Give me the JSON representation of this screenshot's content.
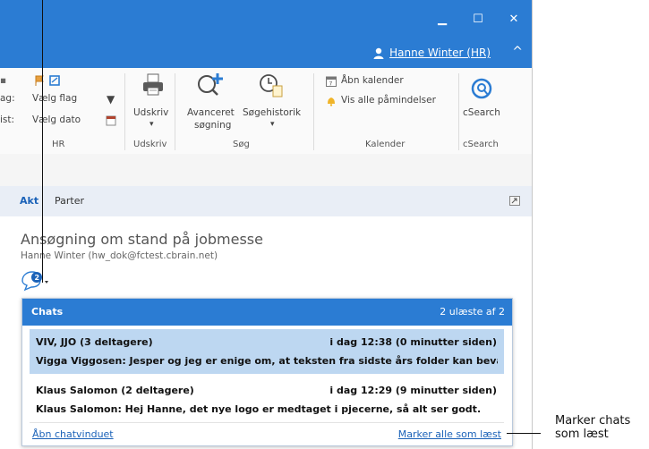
{
  "window": {
    "minimize_glyph": "▁",
    "maximize_glyph": "☐",
    "close_glyph": "✕"
  },
  "user": {
    "name": "Hanne Winter (HR)",
    "collapse_glyph": "^"
  },
  "ribbon": {
    "hr_group": {
      "left_cut_1": "ag:",
      "left_cut_2": "ist:",
      "flag_label": "Vælg flag",
      "date_label": "Vælg dato",
      "group_name": "HR"
    },
    "print_group": {
      "label": "Udskriv",
      "dropdown_glyph": "▾",
      "group_name": "Udskriv"
    },
    "search_group": {
      "advanced_label_1": "Avanceret",
      "advanced_label_2": "søgning",
      "history_label": "Søgehistorik",
      "dropdown_glyph": "▾",
      "group_name": "Søg"
    },
    "calendar_group": {
      "open_label": "Åbn kalender",
      "reminders_label": "Vis alle påmindelser",
      "group_name": "Kalender"
    },
    "csearch_group": {
      "label": "cSearch",
      "group_name": "cSearch"
    }
  },
  "tabs": [
    {
      "label": "Akt"
    },
    {
      "label": "Parter"
    }
  ],
  "document": {
    "subject": "Ansøgning om stand på jobmesse",
    "sender": "Hanne Winter (hw_dok@fctest.cbrain.net)",
    "chat_badge": "2"
  },
  "chats_popup": {
    "title": "Chats",
    "unread_status": "2 ulæste af 2",
    "items": [
      {
        "name": "VIV, JJO (3 deltagere)",
        "time": "i dag 12:38 (0 minutter siden)",
        "message": "Vigga Viggosen: Jesper og jeg er enige om, at teksten fra sidste års folder kan bevar...",
        "selected": true
      },
      {
        "name": "Klaus Salomon (2 deltagere)",
        "time": "i dag 12:29 (9 minutter siden)",
        "message": "Klaus Salomon: Hej Hanne, det nye logo er medtaget i pjecerne, så alt ser godt.",
        "selected": false
      }
    ],
    "open_link": "Åbn chatvinduet",
    "mark_all_link": "Marker alle som læst"
  },
  "annotation": {
    "line1": "Marker chats",
    "line2": "som læst"
  },
  "colors": {
    "accent": "#2b7cd3",
    "selected_row": "#bdd7f1",
    "link": "#1b62b8"
  }
}
